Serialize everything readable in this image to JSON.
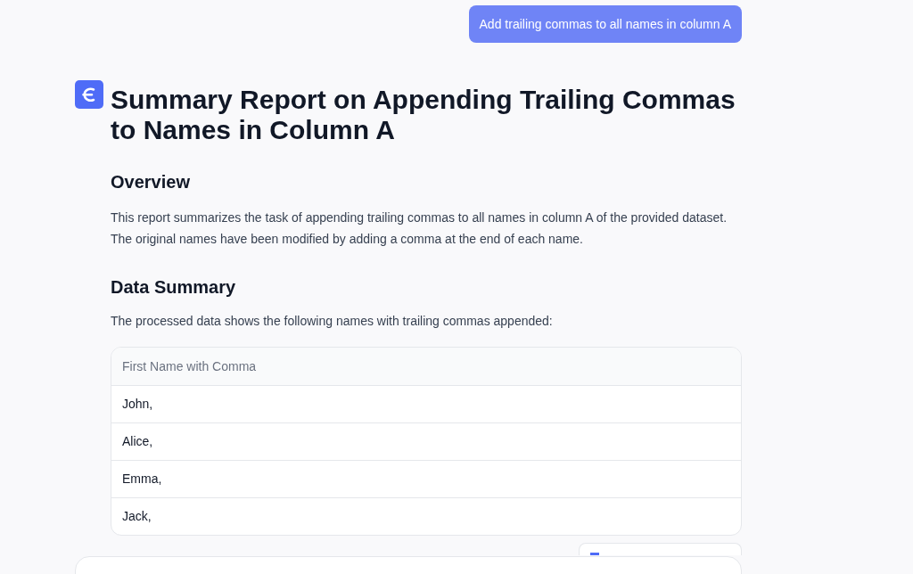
{
  "user_message": {
    "text": "Add trailing commas to all names in column A"
  },
  "report": {
    "title": "Summary Report on Appending Trailing Commas to Names in Column A",
    "sections": [
      {
        "heading": "Overview",
        "paragraph": "This report summarizes the task of appending trailing commas to all names in column A of the provided dataset. The original names have been modified by adding a comma at the end of each name."
      },
      {
        "heading": "Data Summary",
        "paragraph": "The processed data shows the following names with trailing commas appended:",
        "table": {
          "columns": [
            "First Name with Comma"
          ],
          "rows": [
            [
              "John,"
            ],
            [
              "Alice,"
            ],
            [
              "Emma,"
            ],
            [
              "Jack,"
            ]
          ]
        }
      }
    ]
  }
}
